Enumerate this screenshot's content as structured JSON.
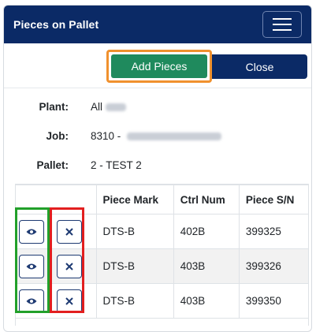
{
  "header": {
    "title": "Pieces on Pallet",
    "menu_icon": "hamburger-icon"
  },
  "actions": {
    "add_label": "Add Pieces",
    "close_label": "Close"
  },
  "info": {
    "plant_label": "Plant:",
    "plant_value": "All",
    "job_label": "Job:",
    "job_value": "8310 -",
    "pallet_label": "Pallet:",
    "pallet_value": "2 - TEST 2"
  },
  "table": {
    "headers": [
      "",
      "Piece Mark",
      "Ctrl Num",
      "Piece S/N"
    ],
    "rows": [
      {
        "piece_mark": "DTS-B",
        "ctrl_num": "402B",
        "piece_sn": "399325"
      },
      {
        "piece_mark": "DTS-B",
        "ctrl_num": "403B",
        "piece_sn": "399326"
      },
      {
        "piece_mark": "DTS-B",
        "ctrl_num": "403B",
        "piece_sn": "399350"
      }
    ]
  },
  "colors": {
    "navy": "#0b2a66",
    "green_button": "#1f8a5d",
    "orange_highlight": "#f0912e",
    "green_highlight": "#22a02a",
    "red_highlight": "#e21f1f"
  }
}
